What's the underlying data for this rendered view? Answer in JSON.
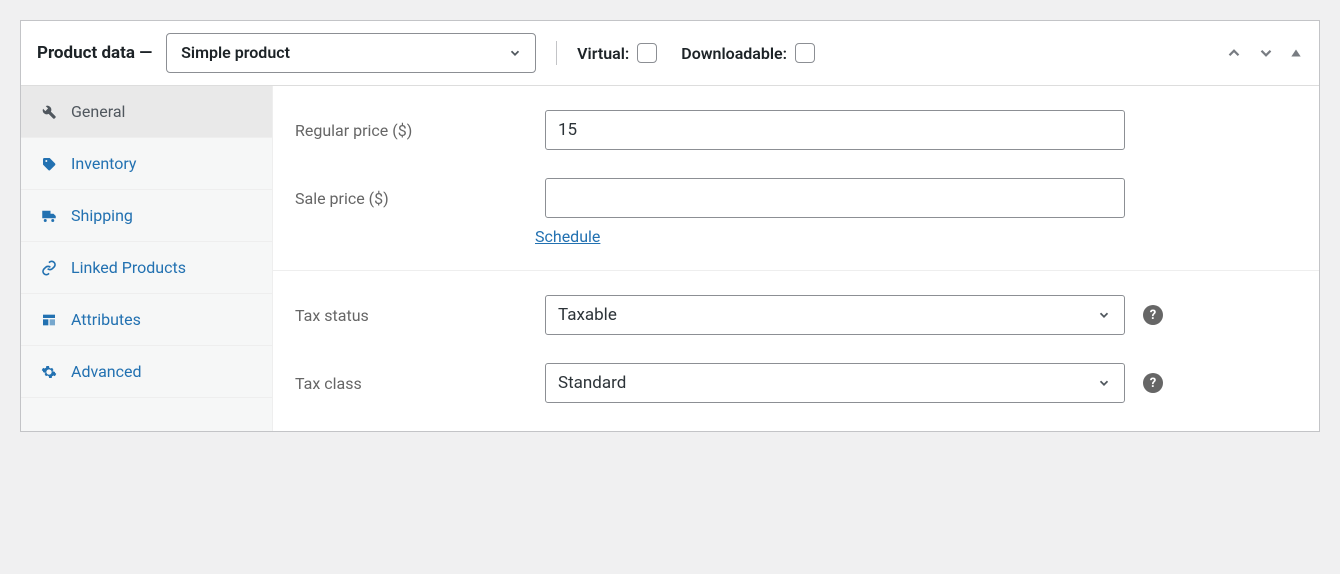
{
  "header": {
    "title": "Product data —",
    "product_type": "Simple product",
    "virtual_label": "Virtual:",
    "downloadable_label": "Downloadable:",
    "virtual": false,
    "downloadable": false
  },
  "tabs": [
    {
      "id": "general",
      "label": "General",
      "icon": "wrench-icon",
      "active": true
    },
    {
      "id": "inventory",
      "label": "Inventory",
      "icon": "tag-icon",
      "active": false
    },
    {
      "id": "shipping",
      "label": "Shipping",
      "icon": "truck-icon",
      "active": false
    },
    {
      "id": "linked",
      "label": "Linked Products",
      "icon": "link-icon",
      "active": false
    },
    {
      "id": "attributes",
      "label": "Attributes",
      "icon": "layout-icon",
      "active": false
    },
    {
      "id": "advanced",
      "label": "Advanced",
      "icon": "gear-icon",
      "active": false
    }
  ],
  "general": {
    "regular_price_label": "Regular price ($)",
    "regular_price": "15",
    "sale_price_label": "Sale price ($)",
    "sale_price": "",
    "schedule": "Schedule",
    "tax_status_label": "Tax status",
    "tax_status": "Taxable",
    "tax_class_label": "Tax class",
    "tax_class": "Standard"
  },
  "icons": {
    "help": "?"
  }
}
